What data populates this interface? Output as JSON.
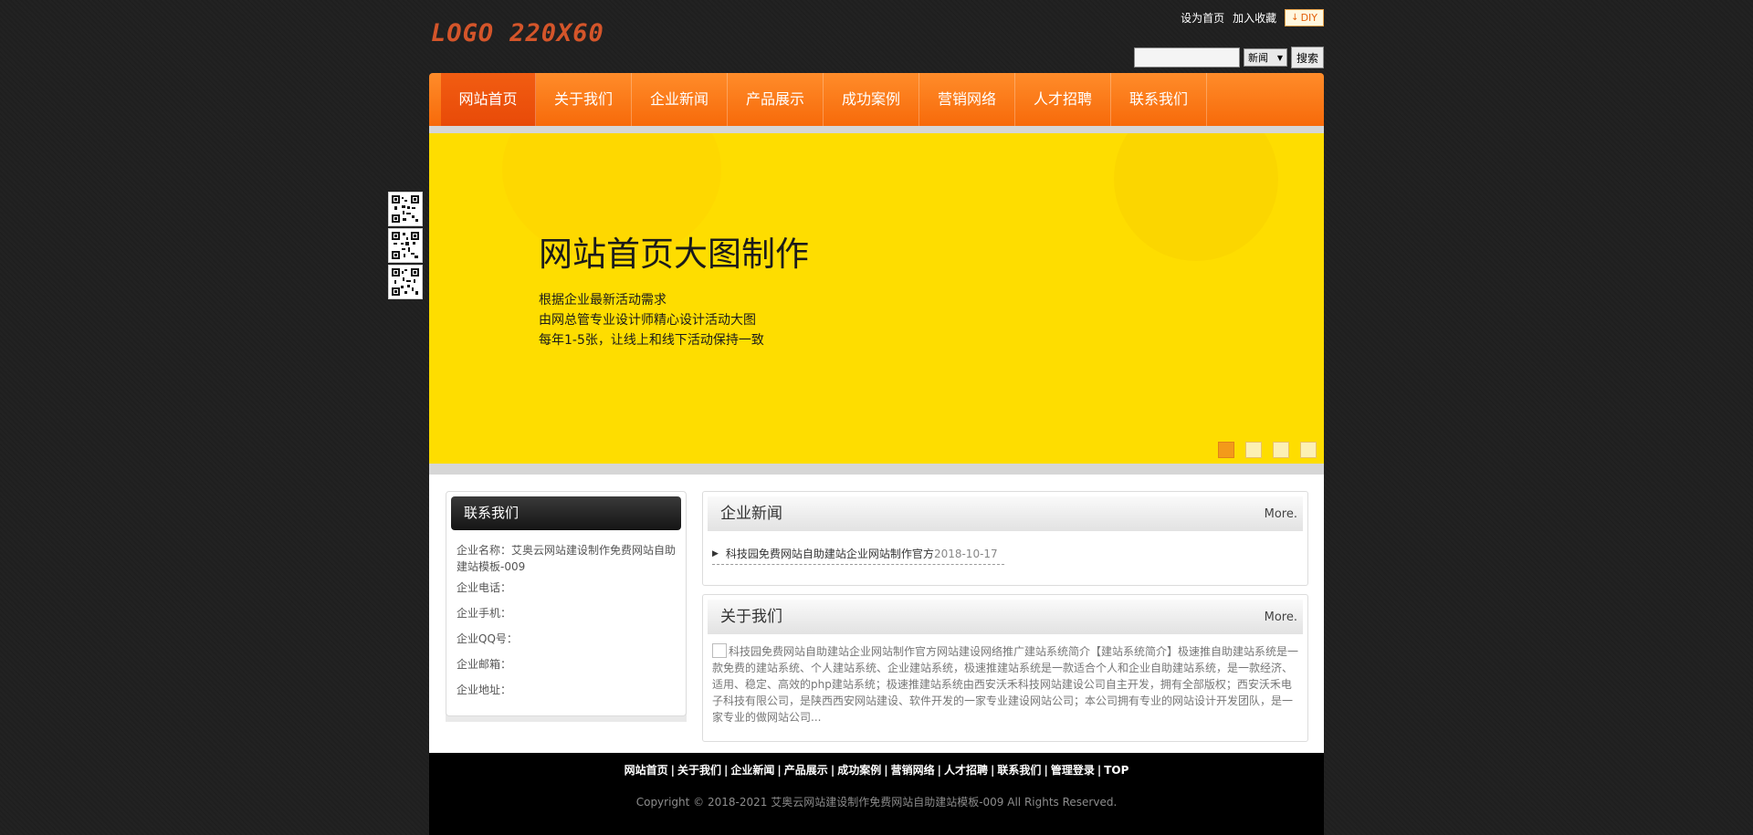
{
  "header": {
    "logo_text": "LOGO 220X60",
    "set_home": "设为首页",
    "add_favorite": "加入收藏",
    "diy": "DIY"
  },
  "search": {
    "input_value": "",
    "category": "新闻",
    "button": "搜索"
  },
  "nav": {
    "items": [
      "网站首页",
      "关于我们",
      "企业新闻",
      "产品展示",
      "成功案例",
      "营销网络",
      "人才招聘",
      "联系我们"
    ],
    "active": 0
  },
  "banner": {
    "title": "网站首页大图制作",
    "lines": [
      "根据企业最新活动需求",
      "由网总管专业设计师精心设计活动大图",
      "每年1-5张，让线上和线下活动保持一致"
    ],
    "slides": 4,
    "current_slide": 1
  },
  "contact": {
    "title": "联系我们",
    "fields": [
      "企业名称：艾奥云网站建设制作免费网站自助建站模板-009",
      "企业电话：",
      "企业手机：",
      "企业QQ号：",
      "企业邮箱：",
      "企业地址："
    ]
  },
  "news": {
    "title": "企业新闻",
    "more": "More.",
    "items": [
      {
        "title": "科技园免费网站自助建站企业网站制作官方",
        "date": "2018-10-17"
      }
    ]
  },
  "about": {
    "title": "关于我们",
    "more": "More.",
    "text": "科技园免费网站自助建站企业网站制作官方网站建设网络推广建站系统简介【建站系统简介】极速推自助建站系统是一款免费的建站系统、个人建站系统、企业建站系统，极速推建站系统是一款适合个人和企业自助建站系统，是一款经济、适用、稳定、高效的php建站系统；极速推建站系统由西安沃禾科技网站建设公司自主开发，拥有全部版权；西安沃禾电子科技有限公司，是陕西西安网站建设、软件开发的一家专业建设网站公司；本公司拥有专业的网站设计开发团队，是一家专业的做网站公司..."
  },
  "footer": {
    "links": [
      "网站首页",
      "关于我们",
      "企业新闻",
      "产品展示",
      "成功案例",
      "营销网络",
      "人才招聘",
      "联系我们",
      "管理登录",
      "TOP"
    ],
    "copyright": "Copyright © 2018-2021 艾奥云网站建设制作免费网站自助建站模板-009 All Rights Reserved."
  },
  "colors": {
    "nav_orange": "#f76a0a",
    "banner_yellow": "#fedd00",
    "logo": "#d4552a",
    "background": "#1f1f1f"
  }
}
